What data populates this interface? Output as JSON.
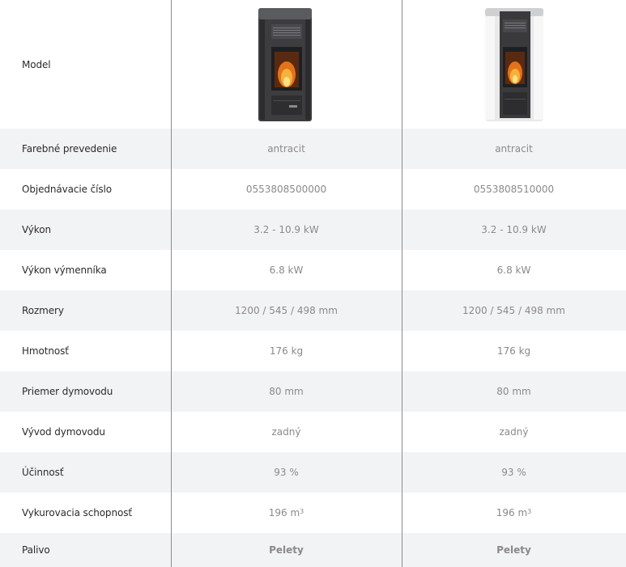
{
  "model_label": "Model",
  "products": [
    {
      "image": "pellet-stove-anthracite-image"
    },
    {
      "image": "pellet-stove-white-image"
    }
  ],
  "rows": [
    {
      "label": "Farebné prevedenie",
      "v1": "antracit",
      "v2": "antracit"
    },
    {
      "label": "Objednávacie číslo",
      "v1": "0553808500000",
      "v2": "0553808510000"
    },
    {
      "label": "Výkon",
      "v1": "3.2 - 10.9 kW",
      "v2": "3.2 - 10.9 kW"
    },
    {
      "label": "Výkon výmenníka",
      "v1": "6.8 kW",
      "v2": "6.8 kW"
    },
    {
      "label": "Rozmery",
      "v1": "1200 / 545 / 498 mm",
      "v2": "1200 / 545 / 498 mm"
    },
    {
      "label": "Hmotnosť",
      "v1": "176 kg",
      "v2": "176 kg"
    },
    {
      "label": "Priemer dymovodu",
      "v1": "80 mm",
      "v2": "80 mm"
    },
    {
      "label": "Vývod dymovodu",
      "v1": "zadný",
      "v2": "zadný"
    },
    {
      "label": "Účinnosť",
      "v1": "93 %",
      "v2": "93 %"
    },
    {
      "label": "Vykurovacia schopnosť",
      "v1": "196 m",
      "v2": "196 m",
      "sup": "3"
    },
    {
      "label": "Palivo",
      "v1": "Pelety",
      "v2": "Pelety"
    }
  ],
  "colors": {
    "row_shade": "#f2f3f5",
    "divider": "#8c8c8c",
    "label_text": "#2b2b2b",
    "value_text": "#8a8a8a"
  }
}
